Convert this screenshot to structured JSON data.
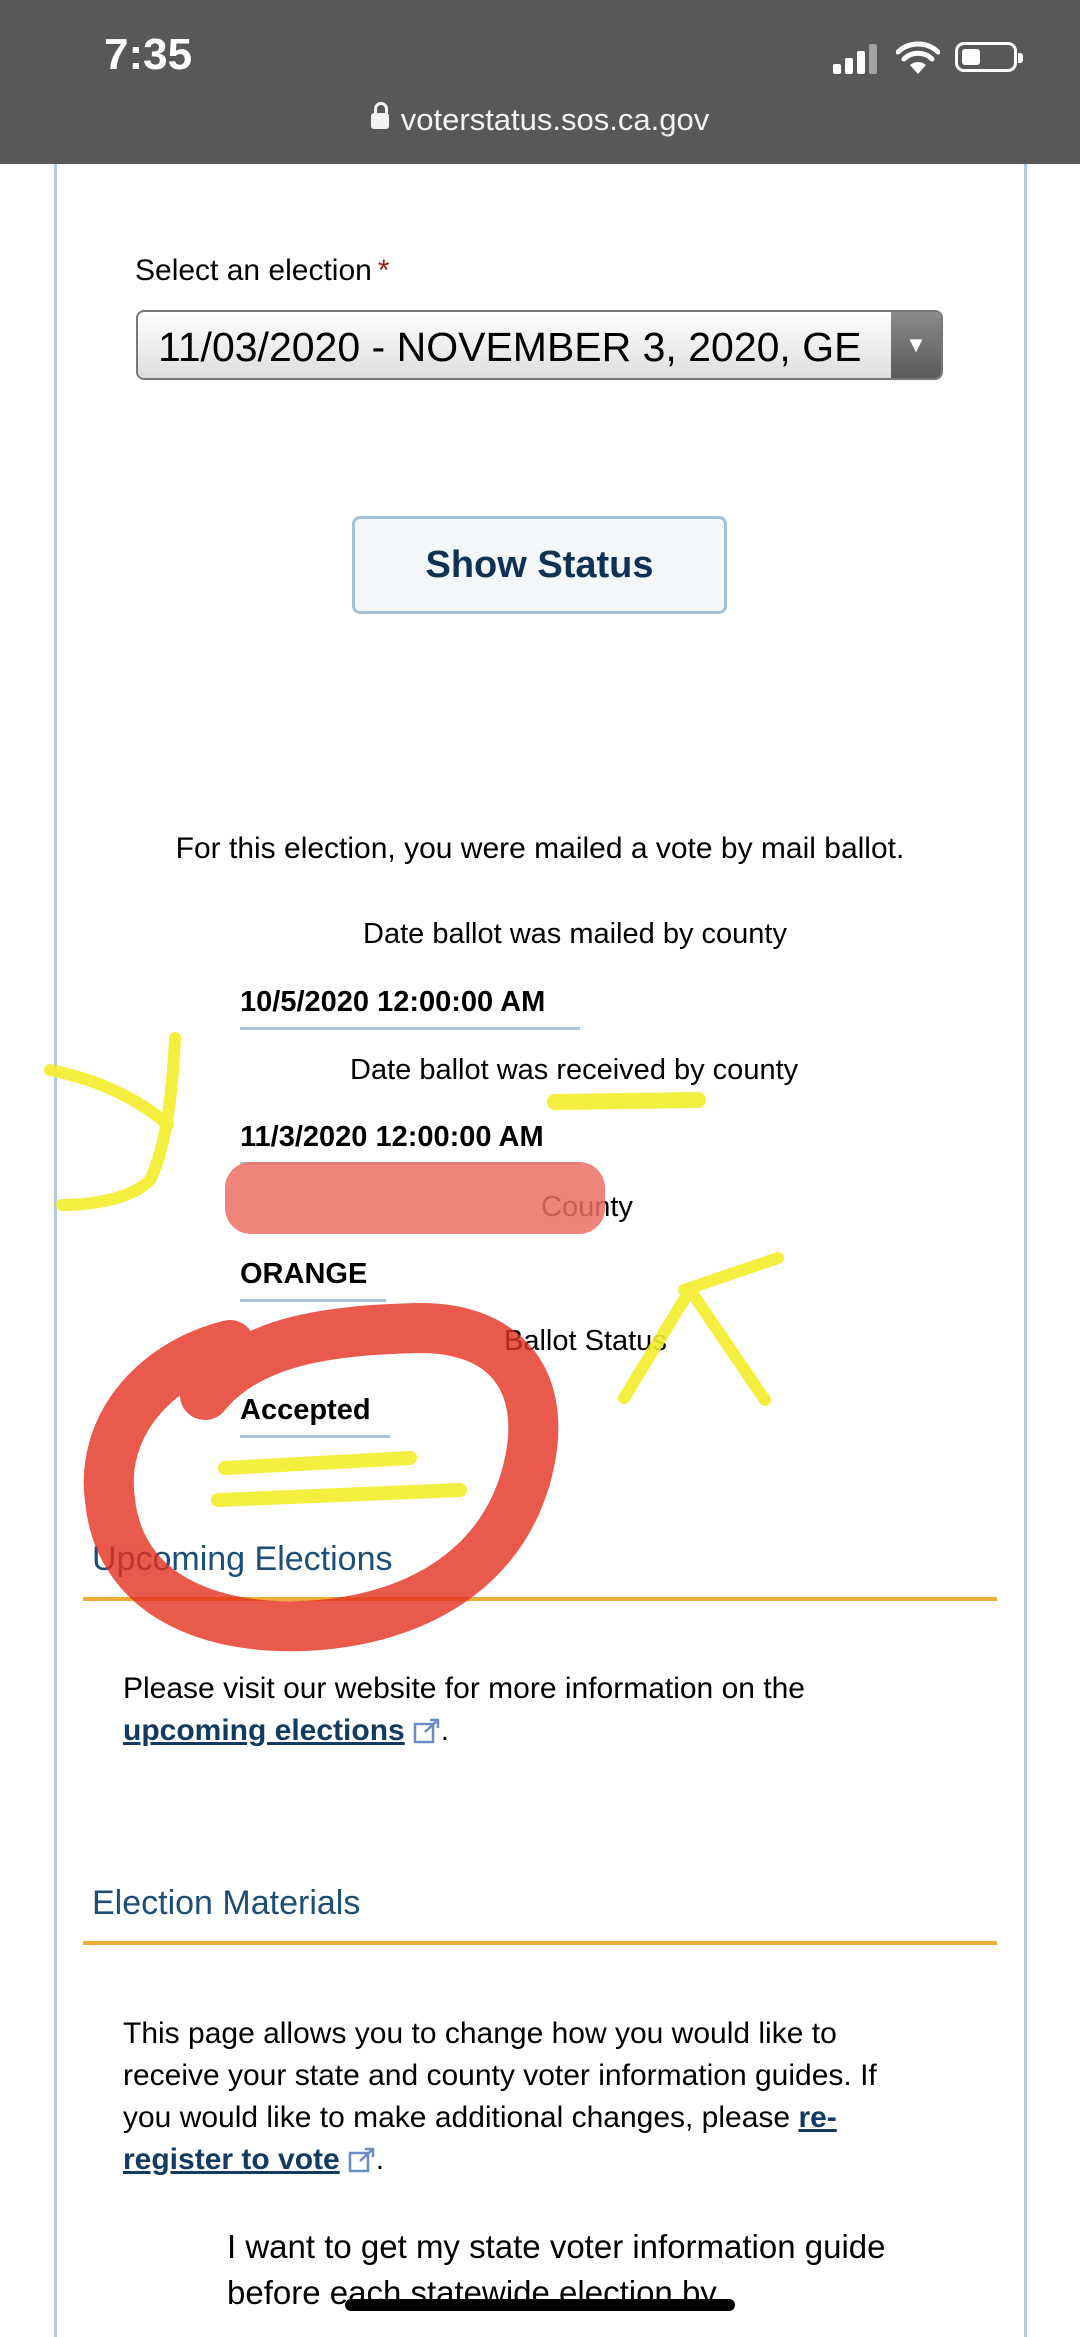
{
  "status_bar": {
    "time": "7:35",
    "url": "voterstatus.sos.ca.gov"
  },
  "election_select": {
    "label": "Select an election",
    "required_marker": "*",
    "selected_value": "11/03/2020 - NOVEMBER 3, 2020, GE"
  },
  "show_status_button": "Show Status",
  "status": {
    "intro": "For this election, you were mailed a vote by mail ballot.",
    "fields": [
      {
        "label": "Date ballot was mailed by county",
        "value": "10/5/2020 12:00:00 AM"
      },
      {
        "label": "Date ballot was received by county",
        "value": "11/3/2020 12:00:00 AM"
      },
      {
        "label": "County",
        "value": "ORANGE"
      },
      {
        "label": "Ballot Status",
        "value": "Accepted"
      }
    ]
  },
  "upcoming": {
    "title": "Upcoming Elections",
    "text": "Please visit our website for more information on the",
    "link": "upcoming elections",
    "tail": "."
  },
  "materials": {
    "title": "Election Materials",
    "line1": "This page allows you to change how you would like to",
    "line2": "receive your state and county voter information guides. If",
    "line3": "you would like to make additional changes, please",
    "link_part1": "re-",
    "link_part2": "register to vote",
    "tail": "."
  },
  "guide_text": {
    "line1": "I want to get my state voter information guide",
    "line2": "before each statewide election by"
  },
  "colors": {
    "status_bar": "#58585b",
    "link": "#133a61",
    "section_title": "#1d4e77",
    "section_rule": "#f0ac36",
    "field_underline": "#a8c4db",
    "annotation_red": "#e0301e",
    "annotation_yellow": "#f3ec2a"
  },
  "icons": [
    "lock-icon",
    "signal-icon",
    "wifi-icon",
    "battery-icon",
    "dropdown-arrow-icon",
    "external-link-icon"
  ]
}
